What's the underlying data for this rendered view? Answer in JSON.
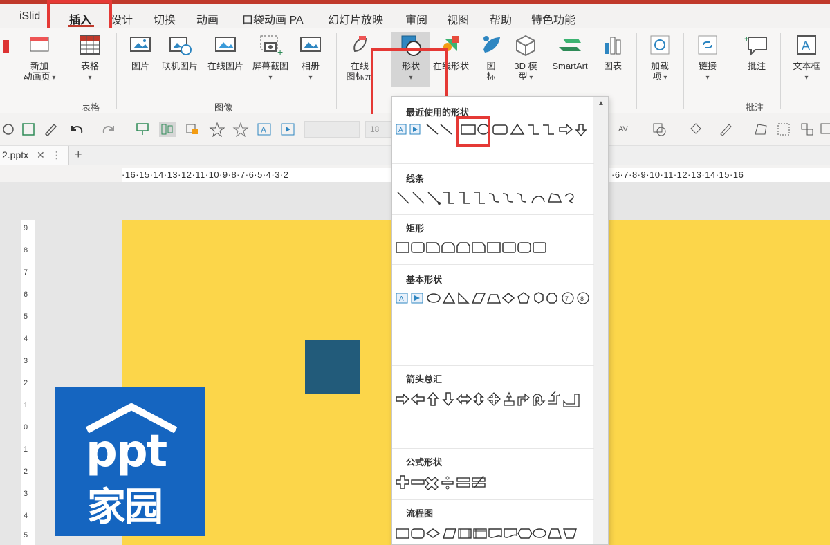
{
  "menu": {
    "tabs": [
      "iSlid",
      "插入",
      "设计",
      "切换",
      "动画",
      "口袋动画 PA",
      "幻灯片放映",
      "审阅",
      "视图",
      "帮助",
      "特色功能"
    ],
    "active_tab": "插入"
  },
  "ribbon": {
    "new_slide": "新加",
    "new_slide_2": "动画页",
    "table": "表格",
    "table_group": "表格",
    "picture": "图片",
    "online_picture_link": "联机图片",
    "online_picture": "在线图片",
    "screenshot": "屏幕截图",
    "album": "相册",
    "image_group": "图像",
    "online_icons": "在线",
    "online_icons_2": "图标元",
    "shapes": "形状",
    "online_shapes": "在线形状",
    "icons": "图",
    "icons_2": "标",
    "model3d": "3D 模",
    "model3d_2": "型",
    "smartart": "SmartArt",
    "chart": "图表",
    "addins": "加载",
    "addins_2": "项",
    "link": "链接",
    "comment": "批注",
    "comment_group": "批注",
    "textbox": "文本框"
  },
  "quickbar": {
    "font_size": "18"
  },
  "doc": {
    "tab_name": "2.pptx",
    "close": "✕",
    "add": "+"
  },
  "ruler": {
    "horizontal_left": "·16·15·14·13·12·11·10·9·8·7·6·5·4·3·2",
    "horizontal_right": "·6·7·8·9·10·11·12·13·14·15·16",
    "vertical": [
      "9",
      "8",
      "7",
      "6",
      "5",
      "4",
      "3",
      "2",
      "1",
      "0",
      "1",
      "2",
      "3",
      "4",
      "5"
    ]
  },
  "logo": {
    "line1": "ppt",
    "line2": "家园"
  },
  "shapes_menu": {
    "sections": [
      "最近使用的形状",
      "线条",
      "矩形",
      "基本形状",
      "箭头总汇",
      "公式形状",
      "流程图"
    ]
  },
  "colors": {
    "accent_red": "#e53935",
    "slide_bg": "#fcd64a",
    "square": "#225b7a",
    "logo_bg": "#1565c0"
  }
}
